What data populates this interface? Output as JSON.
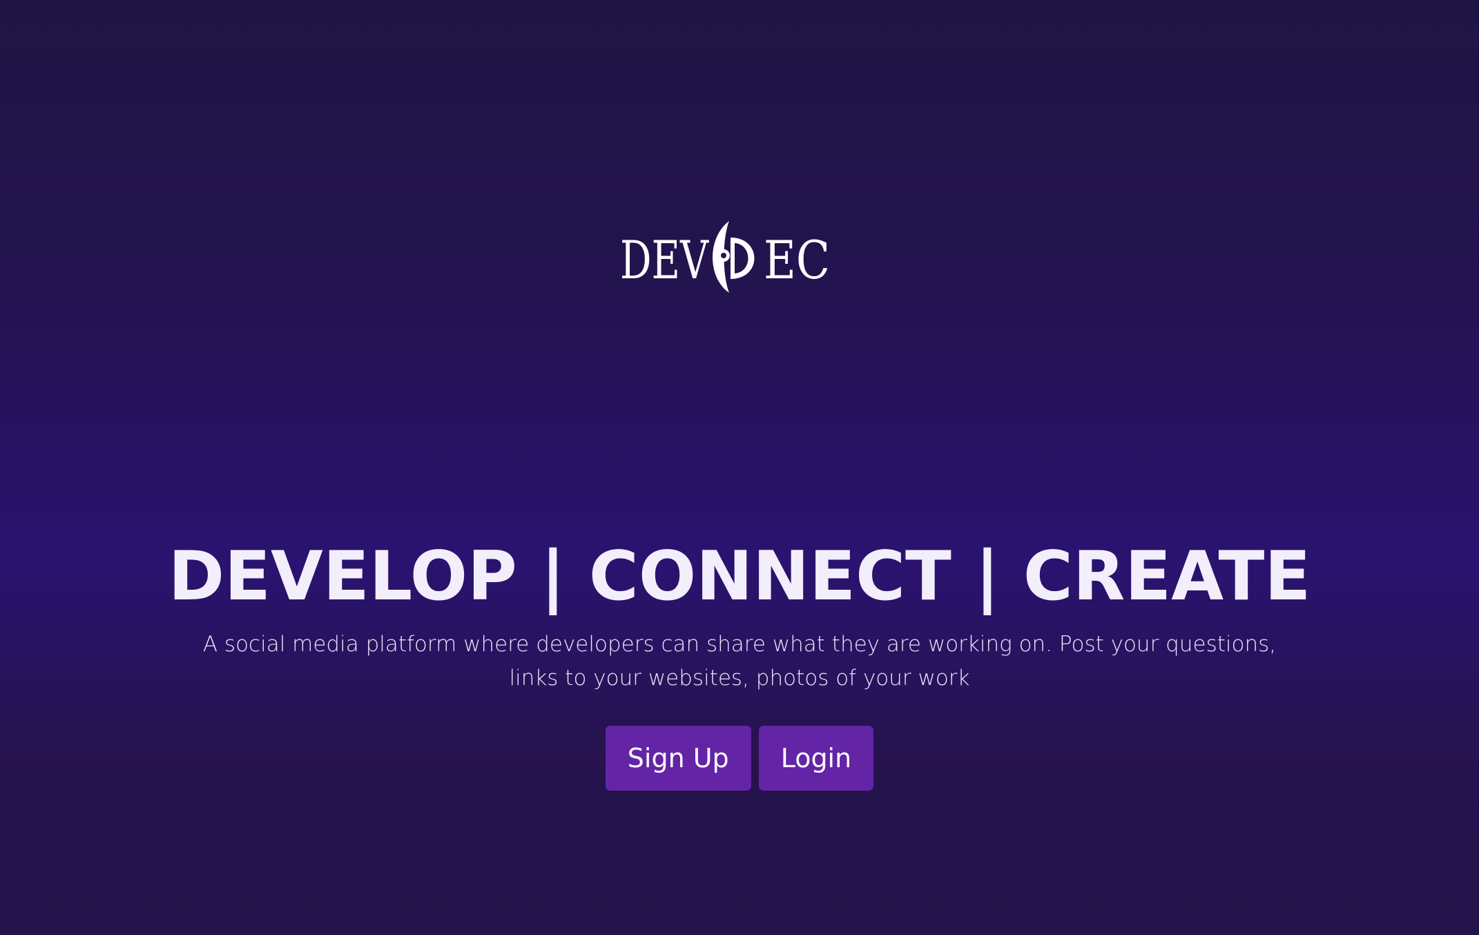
{
  "brand": {
    "logo_text_left": "DEV",
    "logo_text_right": "EC",
    "logo_icon": "d-moon-logo-icon"
  },
  "hero": {
    "headline": "DEVELOP | CONNECT | CREATE",
    "tagline": "A social media platform where developers can share what they are working on. Post your questions, links to your websites, photos of your work"
  },
  "actions": {
    "signup_label": "Sign Up",
    "login_label": "Login"
  },
  "colors": {
    "background": "#2a1370",
    "button": "#6424a6",
    "text": "#f3eefb"
  }
}
